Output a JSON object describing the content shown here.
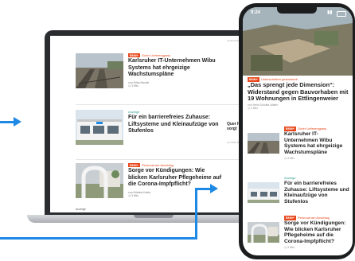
{
  "laptop": {
    "top_label": "Lesenswert",
    "articles": [
      {
        "kicker_badge": "BNN+",
        "kicker_text": "Guter Lieferengpass",
        "title": "Karlsruher IT-Unternehmen Wibu Systems hat ehrgeizige Wachstumspläne",
        "author": "von Erika Nicolai",
        "time": "3 Min."
      },
      {
        "kicker_badge": "",
        "kicker_text": "Anzeige",
        "title": "Für ein barrierefreies Zuhause: Liftsysteme und Kleinaufzüge von Stufenlos",
        "author": "",
        "time": ""
      },
      {
        "kicker_badge": "BNN+",
        "kicker_text": "Personal am Anschlag",
        "title": "Sorge vor Kündigungen: Wie blicken Karlsruher Pflegeheime auf die Corona-Impfpflicht?",
        "author": "von Kristina Krietz",
        "time": "3 Min."
      }
    ],
    "side_items": [
      {
        "small": "von Rothe",
        "text": ""
      },
      {
        "small": "",
        "text": "Quer Hochs sorgt"
      },
      {
        "small": "von Roth Rothe",
        "text": ""
      }
    ],
    "footer_label": "Anzeige"
  },
  "phone": {
    "status_time": "9:24",
    "hero": {
      "kicker_badge": "BNN+",
      "kicker_text": "Unterschriften gesammelt",
      "title": "„Das sprengt jede Dimension“: Widerstand gegen Bauvorhaben mit 19 Wohnungen in Ettlingenweier",
      "author": "von Heidi Schulte-Walter",
      "time": "3 Min."
    },
    "articles": [
      {
        "kicker_badge": "BNN+",
        "kicker_text": "Guter Lieferengpass",
        "title": "Karlsruher IT-Unternehmen Wibu Systems hat ehrgeizige Wachstumspläne",
        "time": "3 Min."
      },
      {
        "kicker_badge": "",
        "kicker_text": "Anzeige",
        "title": "Für ein barrierefreies Zuhause: Liftsysteme und Kleinaufzüge von Stufenlos",
        "time": ""
      },
      {
        "kicker_badge": "BNN+",
        "kicker_text": "Personal am Anschlag",
        "title": "Sorge vor Kündigungen: Wie blicken Karlsruher Pflegeheime auf die Corona-Impfpflicht?",
        "time": "3 Min."
      }
    ]
  },
  "colors": {
    "accent": "#e8481c",
    "teal": "#2a9d8f",
    "arrow": "#1e88e5"
  }
}
